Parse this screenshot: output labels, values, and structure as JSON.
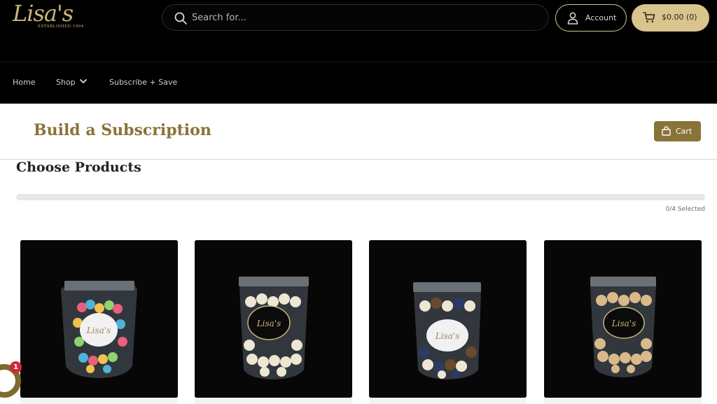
{
  "brand": {
    "logo_script": "Lisa's",
    "logo_tagline": "ESTABLISHED 1994"
  },
  "search": {
    "placeholder": "Search for..."
  },
  "header": {
    "account_label": "Account",
    "cart_label": "$0.00 (0)"
  },
  "nav": {
    "items": [
      {
        "label": "Home"
      },
      {
        "label": "Shop"
      },
      {
        "label": "Subscribe + Save"
      }
    ]
  },
  "subscription": {
    "title": "Build a Subscription",
    "cart_button": "Cart",
    "section_title": "Choose Products",
    "selected_text": "0/4 Selected",
    "selected_count": 0,
    "selected_max": 4
  },
  "products": [
    {
      "icon": "popcorn-bag-colorful",
      "label_style": "white-oval"
    },
    {
      "icon": "popcorn-bag-white",
      "label_style": "black-oval"
    },
    {
      "icon": "popcorn-bag-mixed",
      "label_style": "white-oval"
    },
    {
      "icon": "popcorn-bag-caramel",
      "label_style": "black-oval"
    }
  ],
  "widget": {
    "badge_count": "1"
  },
  "colors": {
    "header_bg": "#000000",
    "accent_gold": "#d9c48e",
    "brand_brown": "#8a7338",
    "badge_red": "#d1283a"
  }
}
